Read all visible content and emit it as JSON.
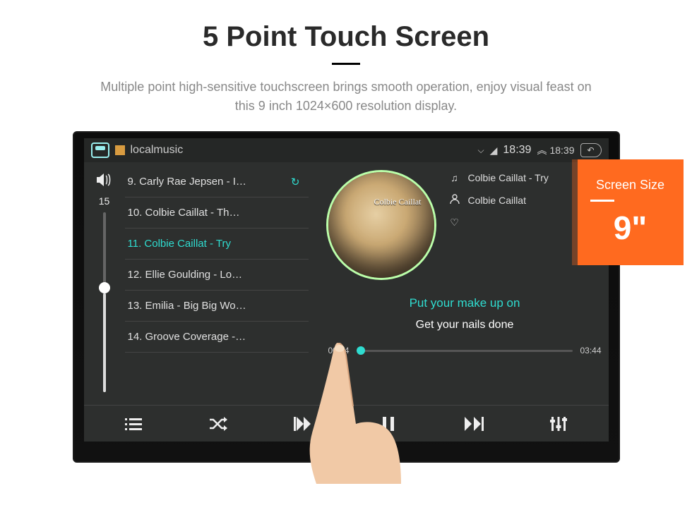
{
  "heading": "5 Point Touch Screen",
  "subheading_l1": "Multiple point high-sensitive touchscreen brings smooth operation, enjoy visual feast on",
  "subheading_l2": "this 9 inch 1024×600 resolution display.",
  "statusbar": {
    "app_title": "localmusic",
    "time_main": "18:39",
    "time_secondary": "18:39"
  },
  "volume": {
    "level": "15"
  },
  "playlist": [
    {
      "label": "9. Carly Rae Jepsen - I…",
      "active": false,
      "reload": true
    },
    {
      "label": "10. Colbie Caillat - Th…",
      "active": false,
      "reload": false
    },
    {
      "label": "11. Colbie Caillat - Try",
      "active": true,
      "reload": false
    },
    {
      "label": "12. Ellie Goulding - Lo…",
      "active": false,
      "reload": false
    },
    {
      "label": "13. Emilia - Big Big Wo…",
      "active": false,
      "reload": false
    },
    {
      "label": "14. Groove Coverage -…",
      "active": false,
      "reload": false
    }
  ],
  "now_playing": {
    "album_text": "Colbie Caillat",
    "song": "Colbie Caillat - Try",
    "artist": "Colbie Caillat",
    "lyric_current": "Put your make up on",
    "lyric_next": "Get your nails done",
    "time_elapsed": "00:04",
    "time_total": "03:44"
  },
  "badge": {
    "title": "Screen Size",
    "value": "9\""
  }
}
